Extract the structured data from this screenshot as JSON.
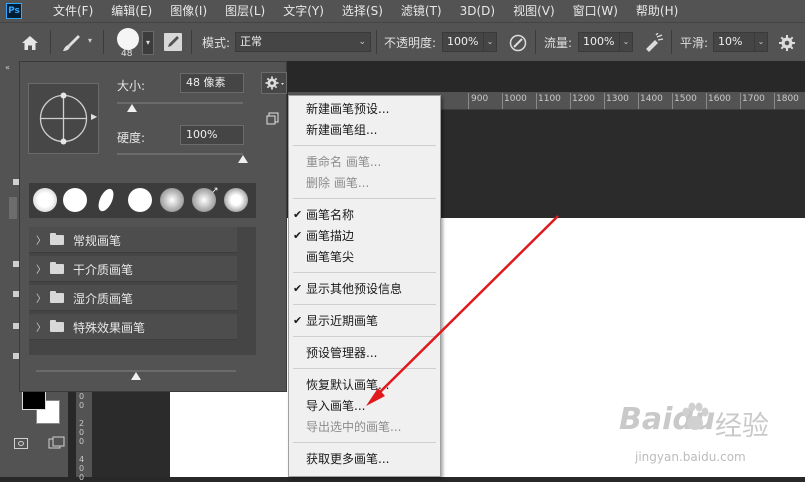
{
  "menubar": {
    "logo": "Ps",
    "items": [
      "文件(F)",
      "编辑(E)",
      "图像(I)",
      "图层(L)",
      "文字(Y)",
      "选择(S)",
      "滤镜(T)",
      "3D(D)",
      "视图(V)",
      "窗口(W)",
      "帮助(H)"
    ]
  },
  "options": {
    "brush_size_value": "48",
    "mode_label": "模式:",
    "mode_value": "正常",
    "opacity_label": "不透明度:",
    "opacity_value": "100%",
    "flow_label": "流量:",
    "flow_value": "100%",
    "smoothing_label": "平滑:",
    "smoothing_value": "10%"
  },
  "brush_panel": {
    "size_label": "大小:",
    "size_value": "48 像素",
    "size_fraction": 0.12,
    "hardness_label": "硬度:",
    "hardness_value": "100%",
    "hardness_fraction": 1.0,
    "preview_slider_fraction": 0.5,
    "folders": [
      "常规画笔",
      "干介质画笔",
      "湿介质画笔",
      "特殊效果画笔"
    ]
  },
  "ruler": {
    "labels": [
      "900",
      "1000",
      "1100",
      "1200",
      "1300",
      "1400",
      "1500",
      "1600",
      "1700",
      "1800"
    ]
  },
  "context_menu": {
    "items": [
      {
        "label": "新建画笔预设...",
        "checked": false,
        "disabled": false
      },
      {
        "label": "新建画笔组...",
        "checked": false,
        "disabled": false
      },
      {
        "label": "重命名 画笔...",
        "checked": false,
        "disabled": true
      },
      {
        "label": "删除 画笔...",
        "checked": false,
        "disabled": true
      },
      {
        "label": "画笔名称",
        "checked": true,
        "disabled": false
      },
      {
        "label": "画笔描边",
        "checked": true,
        "disabled": false
      },
      {
        "label": "画笔笔尖",
        "checked": false,
        "disabled": false
      },
      {
        "label": "显示其他预设信息",
        "checked": true,
        "disabled": false
      },
      {
        "label": "显示近期画笔",
        "checked": true,
        "disabled": false
      },
      {
        "label": "预设管理器...",
        "checked": false,
        "disabled": false
      },
      {
        "label": "恢复默认画笔...",
        "checked": false,
        "disabled": false
      },
      {
        "label": "导入画笔...",
        "checked": false,
        "disabled": false
      },
      {
        "label": "导出选中的画笔...",
        "checked": false,
        "disabled": true
      },
      {
        "label": "获取更多画笔...",
        "checked": false,
        "disabled": false
      }
    ]
  },
  "watermark": {
    "brand": "Baidu",
    "brand_cn": "经验",
    "url": "jingyan.baidu.com"
  },
  "colors": {
    "ui_dark": "#535353",
    "arrow_red": "#e0191e",
    "watermark": "#c9c9c9"
  }
}
